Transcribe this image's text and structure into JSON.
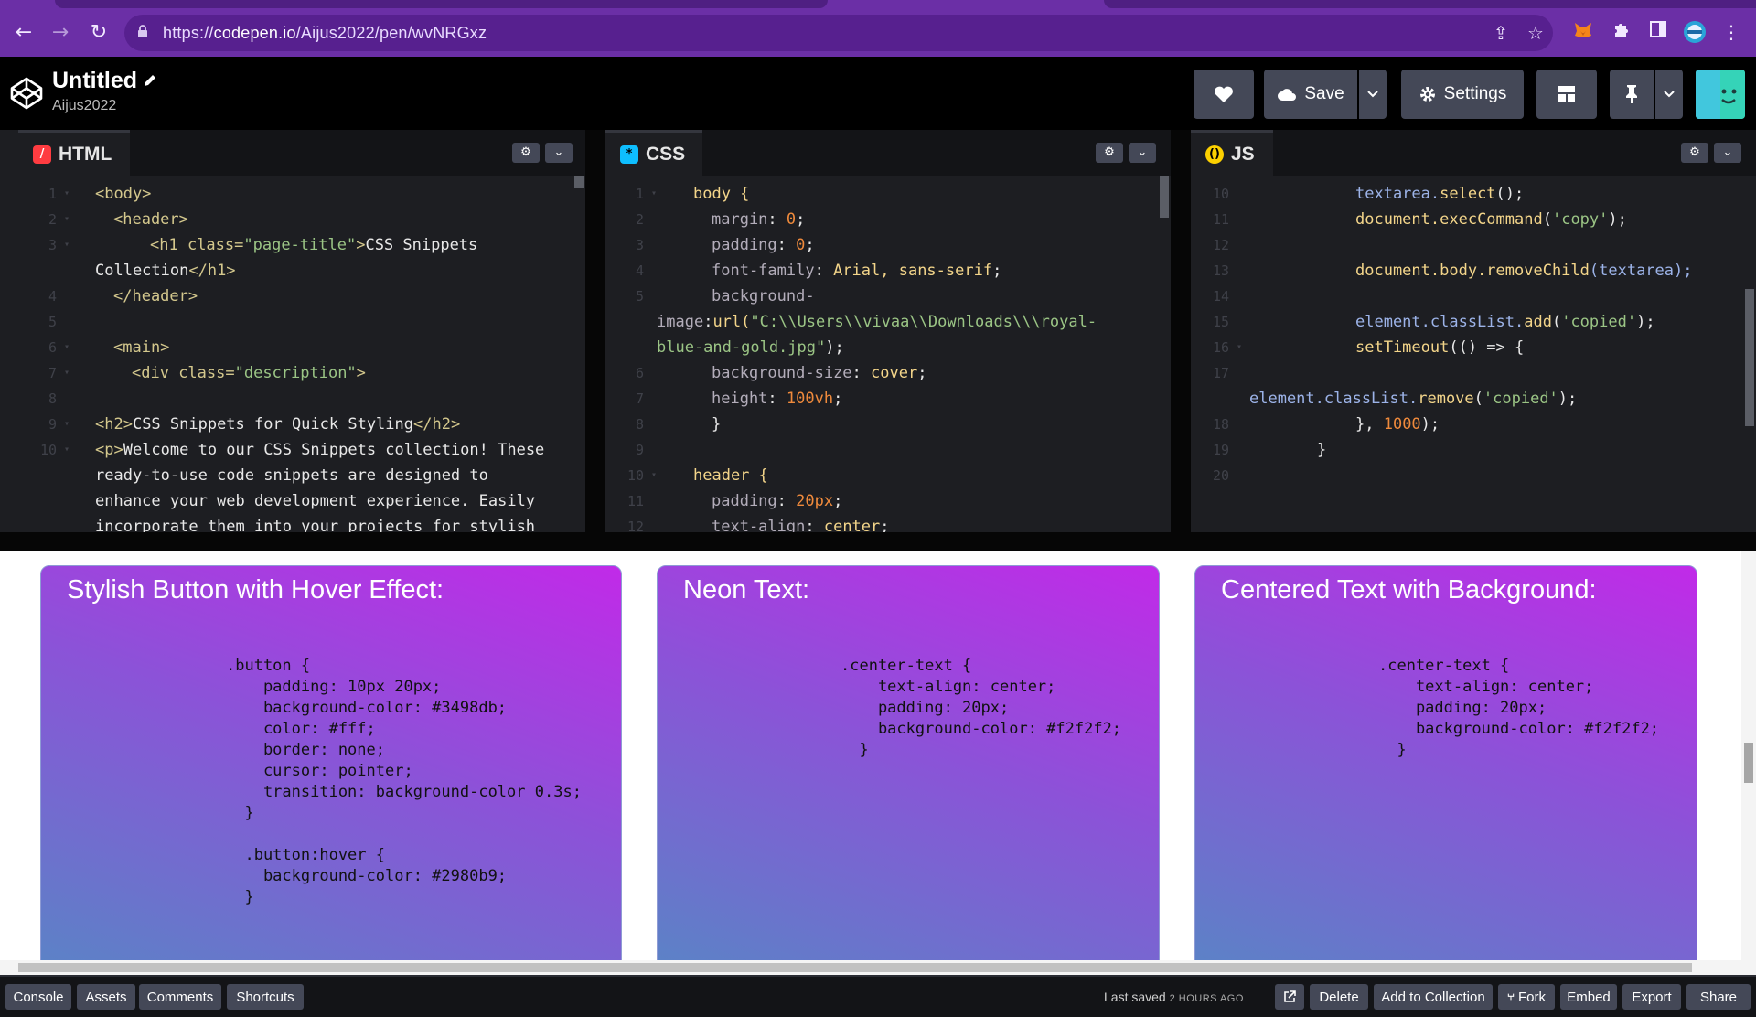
{
  "browser": {
    "url_prefix": "https://",
    "url_host": "codepen.io",
    "url_path": "/Aijus2022/pen/wvNRGxz"
  },
  "header": {
    "title": "Untitled",
    "user": "Aijus2022",
    "save_label": "Save",
    "settings_label": "Settings"
  },
  "editors": {
    "html": {
      "label": "HTML",
      "lines": [
        {
          "n": "1",
          "fold": true,
          "t": "html-body"
        },
        {
          "n": "2",
          "fold": true
        },
        {
          "n": "3",
          "fold": true
        },
        {
          "n": "",
          "fold": false
        },
        {
          "n": "4",
          "fold": false
        },
        {
          "n": "5",
          "fold": false
        },
        {
          "n": "6",
          "fold": true
        },
        {
          "n": "7",
          "fold": true
        },
        {
          "n": "8",
          "fold": false
        },
        {
          "n": "9",
          "fold": true
        },
        {
          "n": "10",
          "fold": true
        }
      ],
      "code": {
        "l1": "<body>",
        "l2": "<header>",
        "l3_open": "<h1 ",
        "l3_attr": "class=",
        "l3_str": "\"page-title\"",
        "l3_close": ">",
        "l3_text": "CSS Snippets",
        "l3b_text": "Collection",
        "l3b_end": "</h1>",
        "l4": "</header>",
        "l6": "<main>",
        "l7_open": "<div ",
        "l7_attr": "class=",
        "l7_str": "\"description\"",
        "l7_close": ">",
        "l9_open": "<h2>",
        "l9_text": "CSS Snippets for Quick Styling",
        "l9_close": "</h2>",
        "l10_open": "<p>",
        "l10_text": "Welcome to our CSS Snippets collection! These",
        "l10b": "ready-to-use code snippets are designed to",
        "l10c": "enhance your web development experience. Easily",
        "l10d": "incorporate them into your projects for stylish"
      }
    },
    "css": {
      "label": "CSS",
      "code": {
        "sel_body": "body {",
        "p_margin": "margin",
        "v_margin": "0",
        "p_padding": "padding",
        "v_padding": "0",
        "p_font": "font-family",
        "v_font": "Arial, sans-serif",
        "p_bg": "background-",
        "p_bg2": "image",
        "v_bg_fn": "url(",
        "v_bg_str": "\"C:\\\\Users\\\\vivaa\\\\Downloads\\\\\\royal-",
        "v_bg_str2": "blue-and-gold.jpg\"",
        "v_bg_end": ");",
        "p_bgsize": "background-size",
        "v_bgsize": "cover",
        "p_height": "height",
        "v_height": "100vh",
        "close": "}",
        "sel_header": "header {",
        "p_hpad": "padding",
        "v_hpad": "20px",
        "p_talign": "text-align",
        "v_talign": "center"
      },
      "line_numbers": [
        "1",
        "2",
        "3",
        "4",
        "5",
        "",
        "6",
        "7",
        "8",
        "9",
        "10",
        "11",
        "12"
      ]
    },
    "js": {
      "label": "JS",
      "line_numbers": [
        "10",
        "11",
        "12",
        "13",
        "14",
        "15",
        "16",
        "17",
        "",
        "18",
        "19",
        "20"
      ],
      "code": {
        "l10a": "textarea.",
        "l10b": "select",
        "l10c": "();",
        "l11a": "document.",
        "l11b": "execCommand",
        "l11c": "(",
        "l11d": "'copy'",
        "l11e": ");",
        "l13a": "document.body.",
        "l13b": "removeChild",
        "l13c": "(textarea);",
        "l15a": "element.classList.",
        "l15b": "add",
        "l15c": "(",
        "l15d": "'copied'",
        "l15e": ");",
        "l16a": "setTimeout",
        "l16b": "(() => {",
        "l17a": "element.classList.",
        "l17b": "remove",
        "l17c": "(",
        "l17d": "'copied'",
        "l17e": ");",
        "l18a": "}, ",
        "l18b": "1000",
        "l18c": ");",
        "l19": "}"
      }
    }
  },
  "preview": {
    "cards": [
      {
        "title": "Stylish Button with Hover Effect:",
        "code": ".button {\n    padding: 10px 20px;\n    background-color: #3498db;\n    color: #fff;\n    border: none;\n    cursor: pointer;\n    transition: background-color 0.3s;\n  }\n\n  .button:hover {\n    background-color: #2980b9;\n  }"
      },
      {
        "title": "Neon Text:",
        "code": ".center-text {\n    text-align: center;\n    padding: 20px;\n    background-color: #f2f2f2;\n  }"
      },
      {
        "title": "Centered Text with Background:",
        "code": ".center-text {\n    text-align: center;\n    padding: 20px;\n    background-color: #f2f2f2;\n  }"
      }
    ]
  },
  "bottombar": {
    "console": "Console",
    "assets": "Assets",
    "comments": "Comments",
    "shortcuts": "Shortcuts",
    "last_saved": "Last saved",
    "last_saved_time": "2 HOURS AGO",
    "delete": "Delete",
    "add_to_collection": "Add to Collection",
    "fork": "Fork",
    "embed": "Embed",
    "export": "Export",
    "share": "Share"
  },
  "colors": {
    "browser_bar": "#6b2fa6",
    "editor_bg": "#1d1e22",
    "button_bg": "#444857",
    "html_badge": "#ff3c41",
    "css_badge": "#0ebeff",
    "js_badge": "#fcd000"
  },
  "icons": [
    "back-arrow-icon",
    "forward-arrow-icon",
    "reload-icon",
    "lock-icon",
    "share-icon",
    "star-icon",
    "metamask-icon",
    "puzzle-extension-icon",
    "side-panel-icon",
    "profile-icon",
    "kebab-menu-icon",
    "codepen-logo-icon",
    "pencil-icon",
    "heart-icon",
    "cloud-icon",
    "gear-icon",
    "layout-grid-icon",
    "pin-icon",
    "chevron-down-icon",
    "external-link-icon",
    "fork-icon"
  ]
}
